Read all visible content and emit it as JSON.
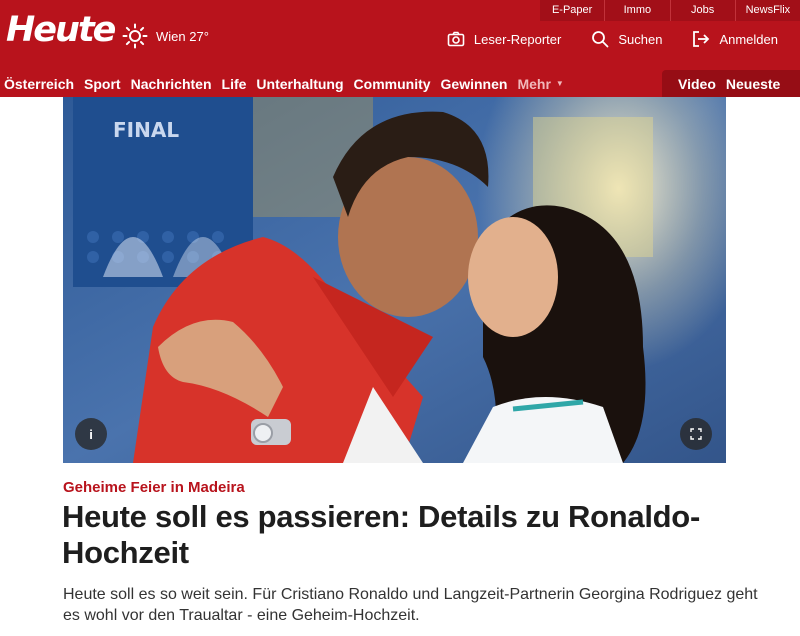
{
  "header": {
    "logo": "Heute",
    "weather": {
      "icon": "sun-icon",
      "location_temp": "Wien 27°"
    },
    "utility_links": [
      "E-Paper",
      "Immo",
      "Jobs",
      "NewsFlix"
    ],
    "actions": [
      {
        "icon": "camera-icon",
        "label": "Leser-Reporter"
      },
      {
        "icon": "search-icon",
        "label": "Suchen"
      },
      {
        "icon": "login-icon",
        "label": "Anmelden"
      }
    ],
    "nav": [
      "Österreich",
      "Sport",
      "Nachrichten",
      "Life",
      "Unterhaltung",
      "Community",
      "Gewinnen"
    ],
    "nav_more": "Mehr",
    "nav_right": [
      "Video",
      "Neueste"
    ]
  },
  "hero": {
    "info_icon": "info-icon",
    "info_label": "i",
    "expand_icon": "expand-icon",
    "background_text": "FINAL"
  },
  "article": {
    "kicker": "Geheime Feier in Madeira",
    "headline": "Heute soll es passieren: Details zu Ronaldo-Hochzeit",
    "lead": "Heute soll es so weit sein. Für Cristiano Ronaldo und Langzeit-Partnerin Georgina Rodriguez geht es wohl vor den Traualtar - eine Geheim-Hochzeit."
  },
  "colors": {
    "brand_red": "#b8131c",
    "utility_red": "#a20f18",
    "nav_dark_red": "#960d15",
    "text_dark": "#1e1e1e"
  }
}
